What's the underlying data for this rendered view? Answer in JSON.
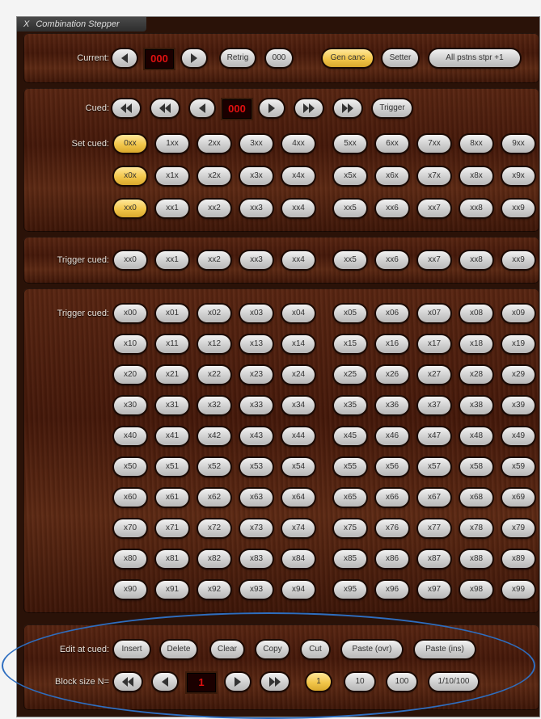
{
  "title": "Combination Stepper",
  "close_glyph": "X",
  "current": {
    "label": "Current:",
    "display": "000",
    "retrig": "Retrig",
    "zero": "000",
    "gen_canc": "Gen canc",
    "setter": "Setter",
    "all_pstns": "All pstns stpr +1"
  },
  "cued": {
    "label": "Cued:",
    "display": "000",
    "trigger": "Trigger",
    "set_label": "Set cued:",
    "row1": [
      "0xx",
      "1xx",
      "2xx",
      "3xx",
      "4xx",
      "5xx",
      "6xx",
      "7xx",
      "8xx",
      "9xx"
    ],
    "row2": [
      "x0x",
      "x1x",
      "x2x",
      "x3x",
      "x4x",
      "x5x",
      "x6x",
      "x7x",
      "x8x",
      "x9x"
    ],
    "row3": [
      "xx0",
      "xx1",
      "xx2",
      "xx3",
      "xx4",
      "xx5",
      "xx6",
      "xx7",
      "xx8",
      "xx9"
    ]
  },
  "trigger1": {
    "label": "Trigger cued:",
    "items": [
      "xx0",
      "xx1",
      "xx2",
      "xx3",
      "xx4",
      "xx5",
      "xx6",
      "xx7",
      "xx8",
      "xx9"
    ]
  },
  "trigger2": {
    "label": "Trigger cued:",
    "rows": [
      [
        "x00",
        "x01",
        "x02",
        "x03",
        "x04",
        "x05",
        "x06",
        "x07",
        "x08",
        "x09"
      ],
      [
        "x10",
        "x11",
        "x12",
        "x13",
        "x14",
        "x15",
        "x16",
        "x17",
        "x18",
        "x19"
      ],
      [
        "x20",
        "x21",
        "x22",
        "x23",
        "x24",
        "x25",
        "x26",
        "x27",
        "x28",
        "x29"
      ],
      [
        "x30",
        "x31",
        "x32",
        "x33",
        "x34",
        "x35",
        "x36",
        "x37",
        "x38",
        "x39"
      ],
      [
        "x40",
        "x41",
        "x42",
        "x43",
        "x44",
        "x45",
        "x46",
        "x47",
        "x48",
        "x49"
      ],
      [
        "x50",
        "x51",
        "x52",
        "x53",
        "x54",
        "x55",
        "x56",
        "x57",
        "x58",
        "x59"
      ],
      [
        "x60",
        "x61",
        "x62",
        "x63",
        "x64",
        "x65",
        "x66",
        "x67",
        "x68",
        "x69"
      ],
      [
        "x70",
        "x71",
        "x72",
        "x73",
        "x74",
        "x75",
        "x76",
        "x77",
        "x78",
        "x79"
      ],
      [
        "x80",
        "x81",
        "x82",
        "x83",
        "x84",
        "x85",
        "x86",
        "x87",
        "x88",
        "x89"
      ],
      [
        "x90",
        "x91",
        "x92",
        "x93",
        "x94",
        "x95",
        "x96",
        "x97",
        "x98",
        "x99"
      ]
    ]
  },
  "edit": {
    "label": "Edit at cued:",
    "insert": "Insert",
    "delete": "Delete",
    "clear": "Clear",
    "copy": "Copy",
    "cut": "Cut",
    "paste_ovr": "Paste (ovr)",
    "paste_ins": "Paste (ins)",
    "block_label": "Block size N=",
    "block_display": "1",
    "one": "1",
    "ten": "10",
    "hundred": "100",
    "cycle": "1/10/100"
  },
  "colors": {
    "wood": "#4a1c0a",
    "button": "#d8d8d8",
    "button_active": "#f2c64a",
    "display_text": "#e01010",
    "annotation_oval": "#2e6ec0"
  }
}
